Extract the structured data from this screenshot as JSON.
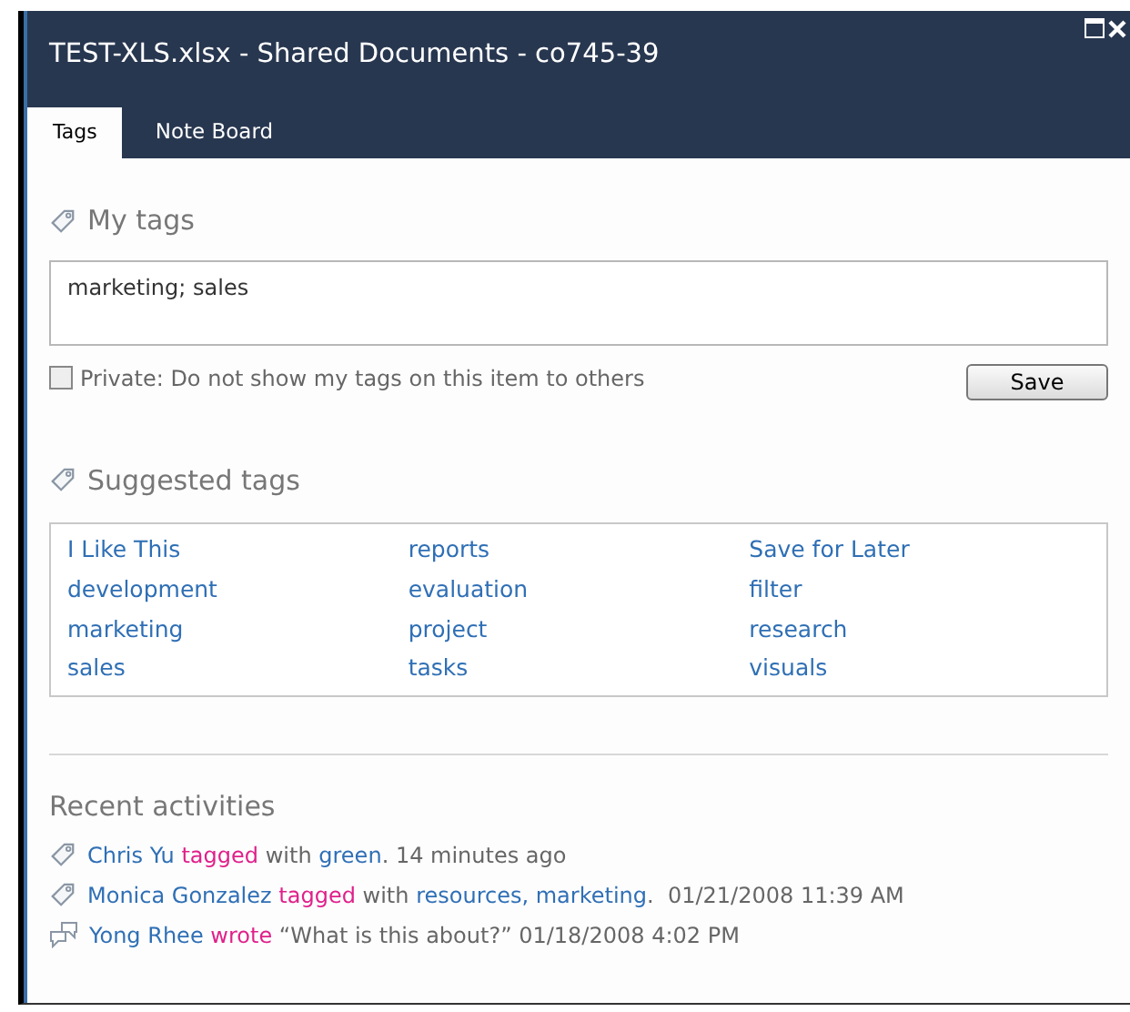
{
  "window": {
    "title": "TEST-XLS.xlsx - Shared Documents - co745-39"
  },
  "tabs": [
    {
      "label": "Tags",
      "selected": true
    },
    {
      "label": "Note Board",
      "selected": false
    }
  ],
  "my_tags": {
    "heading": "My tags",
    "value": "marketing; sales",
    "private": {
      "label": "Private: Do not show my tags on this item to others",
      "checked": false
    },
    "save": "Save"
  },
  "suggested_tags": {
    "heading": "Suggested tags",
    "items": [
      "I Like This",
      "reports",
      "Save for Later",
      "development",
      "evaluation",
      "filter",
      "marketing",
      "project",
      "research",
      "sales",
      "tasks",
      "visuals"
    ]
  },
  "recent_activities": {
    "heading": "Recent activities",
    "items": [
      {
        "kind": "tag",
        "parts": [
          {
            "kind": "link",
            "text": "Chris Yu"
          },
          {
            "kind": "action",
            "text": "tagged"
          },
          {
            "kind": "plain",
            "text": "with"
          },
          {
            "kind": "link",
            "text": "green"
          },
          {
            "kind": "plain",
            "text": ". 14 minutes ago",
            "attach": true
          }
        ]
      },
      {
        "kind": "tag",
        "parts": [
          {
            "kind": "link",
            "text": "Monica Gonzalez"
          },
          {
            "kind": "action",
            "text": "tagged"
          },
          {
            "kind": "plain",
            "text": "with"
          },
          {
            "kind": "link",
            "text": "resources, marketing"
          },
          {
            "kind": "plain",
            "text": ".  01/21/2008 11:39 AM",
            "attach": true
          }
        ]
      },
      {
        "kind": "note",
        "parts": [
          {
            "kind": "link",
            "text": "Yong Rhee"
          },
          {
            "kind": "action",
            "text": "wrote"
          },
          {
            "kind": "plain",
            "text": "“What is this about?” 01/18/2008 4:02 PM"
          }
        ]
      }
    ]
  }
}
